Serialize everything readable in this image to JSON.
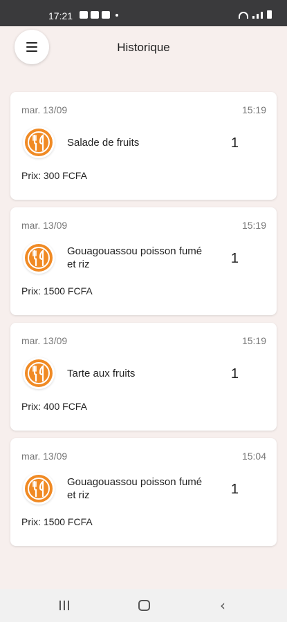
{
  "status_bar": {
    "time": "17:21"
  },
  "header": {
    "title": "Historique",
    "menu_icon": "hamburger-menu-icon"
  },
  "theme": {
    "accent": "#f08a24",
    "background": "#f7efed"
  },
  "orders": [
    {
      "date": "mar. 13/09",
      "time": "15:19",
      "name": "Salade de fruits",
      "quantity": "1",
      "price": "Prix: 300 FCFA"
    },
    {
      "date": "mar. 13/09",
      "time": "15:19",
      "name": "Gouagouassou poisson fumé et riz",
      "quantity": "1",
      "price": "Prix: 1500 FCFA"
    },
    {
      "date": "mar. 13/09",
      "time": "15:19",
      "name": "Tarte aux fruits",
      "quantity": "1",
      "price": "Prix: 400 FCFA"
    },
    {
      "date": "mar. 13/09",
      "time": "15:04",
      "name": "Gouagouassou poisson fumé et riz",
      "quantity": "1",
      "price": "Prix: 1500 FCFA"
    }
  ],
  "nav_bar": {
    "icons": [
      "recent-apps-icon",
      "home-icon",
      "back-icon"
    ]
  }
}
